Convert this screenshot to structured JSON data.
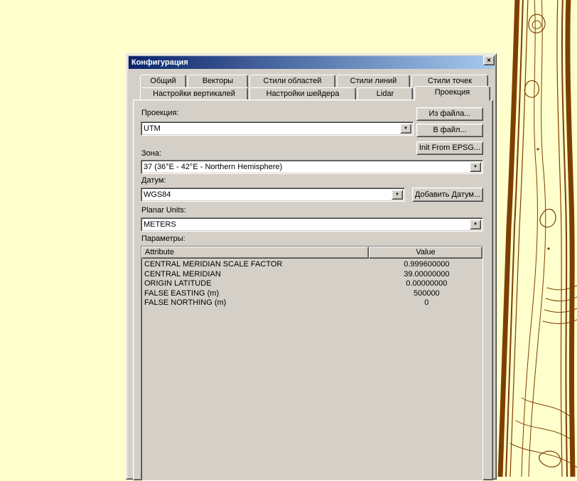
{
  "window": {
    "title": "Конфигурация"
  },
  "icons": {
    "close": "×",
    "dropdown": "▼"
  },
  "tabs": {
    "row1": [
      "Общий",
      "Векторы",
      "Стили областей",
      "Стили линий",
      "Стили точек"
    ],
    "row2": [
      "Настройки вертикалей",
      "Настройки шейдера",
      "Lidar",
      "Проекция"
    ],
    "active": "Проекция"
  },
  "fields": {
    "projection": {
      "label": "Проекция:",
      "value": "UTM"
    },
    "zone": {
      "label": "Зона:",
      "value": "37 (36°E - 42°E - Northern Hemisphere)"
    },
    "datum": {
      "label": "Датум:",
      "value": "WGS84"
    },
    "planar_units": {
      "label": "Planar Units:",
      "value": "METERS"
    }
  },
  "buttons": {
    "from_file": "Из файла...",
    "to_file": "В файл...",
    "init_epsg": "Init From EPSG...",
    "add_datum": "Добавить Датум..."
  },
  "parameters": {
    "label": "Параметры:",
    "columns": [
      "Attribute",
      "Value"
    ],
    "rows": [
      {
        "attribute": "CENTRAL MERIDIAN SCALE FACTOR",
        "value": "0.999600000"
      },
      {
        "attribute": "CENTRAL MERIDIAN",
        "value": "39.00000000"
      },
      {
        "attribute": "ORIGIN LATITUDE",
        "value": "0.00000000"
      },
      {
        "attribute": "FALSE EASTING (m)",
        "value": "500000"
      },
      {
        "attribute": "FALSE NORTHING (m)",
        "value": "0"
      }
    ]
  },
  "colors": {
    "desktop_bg": "#FFFFCD",
    "contour": "#7D3F00",
    "dialog_face": "#D4D0C8",
    "title_gradient_start": "#0A246A",
    "title_gradient_end": "#A6CAF0"
  }
}
